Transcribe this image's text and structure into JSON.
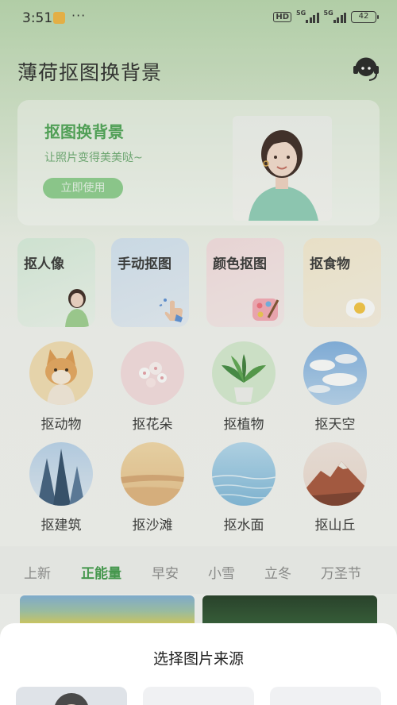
{
  "status_bar": {
    "time": "3:51",
    "more": "···",
    "hd": "HD",
    "net1": "5G",
    "net2": "5G",
    "battery": "42"
  },
  "header": {
    "title": "薄荷抠图换背景"
  },
  "banner": {
    "title": "抠图换背景",
    "subtitle": "让照片变得美美哒~",
    "button": "立即使用"
  },
  "tools": [
    {
      "label": "抠人像",
      "icon": "portrait-icon"
    },
    {
      "label": "手动抠图",
      "icon": "hand-cursor-icon"
    },
    {
      "label": "颜色抠图",
      "icon": "palette-icon"
    },
    {
      "label": "抠食物",
      "icon": "fried-egg-icon"
    }
  ],
  "categories": [
    {
      "label": "抠动物"
    },
    {
      "label": "抠花朵"
    },
    {
      "label": "抠植物"
    },
    {
      "label": "抠天空"
    },
    {
      "label": "抠建筑"
    },
    {
      "label": "抠沙滩"
    },
    {
      "label": "抠水面"
    },
    {
      "label": "抠山丘"
    }
  ],
  "tabs": [
    {
      "label": "上新"
    },
    {
      "label": "正能量",
      "active": true
    },
    {
      "label": "早安"
    },
    {
      "label": "小雪"
    },
    {
      "label": "立冬"
    },
    {
      "label": "万圣节"
    }
  ],
  "sheet": {
    "title": "选择图片来源"
  },
  "colors": {
    "accent": "#3e9a48",
    "banner_title": "#4ba352",
    "button": "#8ccf8d"
  }
}
